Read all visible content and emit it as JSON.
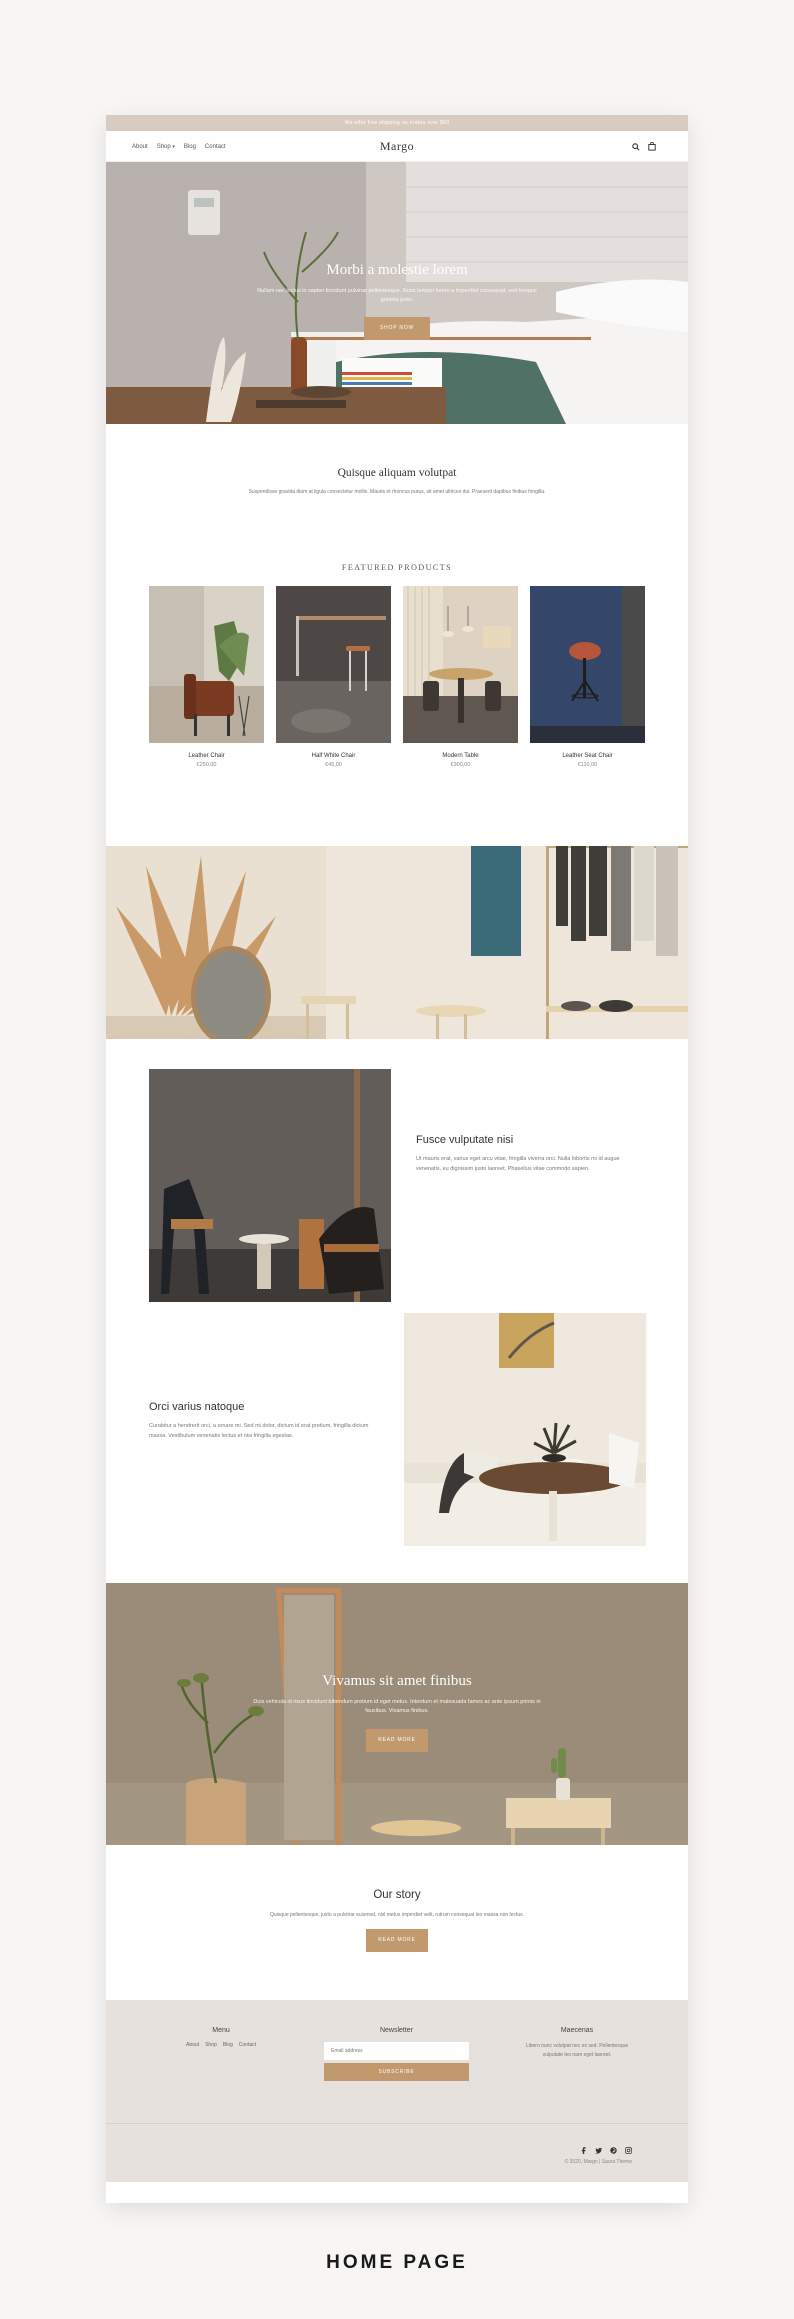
{
  "announcement": "We offer free shipping on orders over $60",
  "nav": {
    "items": [
      "About",
      "Shop",
      "Blog",
      "Contact"
    ]
  },
  "logo": "Margo",
  "icons": {
    "search": "search-icon",
    "cart": "bag-icon",
    "dropdown": "chevron-down-icon"
  },
  "hero": {
    "title": "Morbi a molestie lorem",
    "subtitle": "Nullam nec lectus in sapien tincidunt pulvinar pellentesque. Nunc tempor lorem a imperdiet consequat, sed tempus gravida justo.",
    "button": "SHOP NOW"
  },
  "intro": {
    "title": "Quisque aliquam volutpat",
    "text": "Suspendisse gravida diam at ligula consectetur mollis. Mauris et rhoncus purus, sit amet ultrices dui. Praesent dapibus finibus fringilla."
  },
  "featured": {
    "heading": "FEATURED PRODUCTS",
    "products": [
      {
        "name": "Leather Chair",
        "price": "€250,00"
      },
      {
        "name": "Half White Chair",
        "price": "€45,00"
      },
      {
        "name": "Modern Table",
        "price": "€300,00"
      },
      {
        "name": "Leather Seat Chair",
        "price": "€110,00"
      }
    ]
  },
  "feature1": {
    "title": "Fusce vulputate nisi",
    "text": "Ut mauris erat, varius eget arcu vitae, fringilla viverra orci. Nulla lobortis mi id augue venenatis, eu dignissim justo laoreet. Phasellus vitae commodo sapien."
  },
  "feature2": {
    "title": "Orci varius natoque",
    "text": "Curabitur a hendrerit orci, a ornare mi. Sed mi dolor, dictum id erat pretium, fringilla dictum massa. Vestibulum venenatis lectus et nisi fringilla egestas."
  },
  "banner": {
    "title": "Vivamus sit amet finibus",
    "subtitle": "Duis vehicula id risus tincidunt bibendum pretium id eget metus. Interdum et malesuada fames ac ante ipsum primis in faucibus. Vivamus finibus.",
    "button": "READ MORE"
  },
  "story": {
    "title": "Our story",
    "text": "Quisque pellentesque, justo a pulvinar euismod, nisl metus imperdiet velit, rutrum consequat leo massa non lectus.",
    "button": "READ MORE"
  },
  "footer": {
    "menu_title": "Menu",
    "menu_items": [
      "About",
      "Shop",
      "Blog",
      "Contact"
    ],
    "newsletter_title": "Newsletter",
    "email_placeholder": "Email address",
    "subscribe": "SUBSCRIBE",
    "about_title": "Maecenas",
    "about_text": "Libero nunc volutpat nec ex sed. Pellentesque vulputate leo nam eget laoreet.",
    "social": [
      "facebook-icon",
      "twitter-icon",
      "pinterest-icon",
      "instagram-icon"
    ],
    "copyright": "© 2020, Margo | Saura Theme"
  },
  "caption": "HOME PAGE",
  "colors": {
    "accent": "#c2996d",
    "announce": "#d9cbc1",
    "footer": "#e6e1dc"
  }
}
